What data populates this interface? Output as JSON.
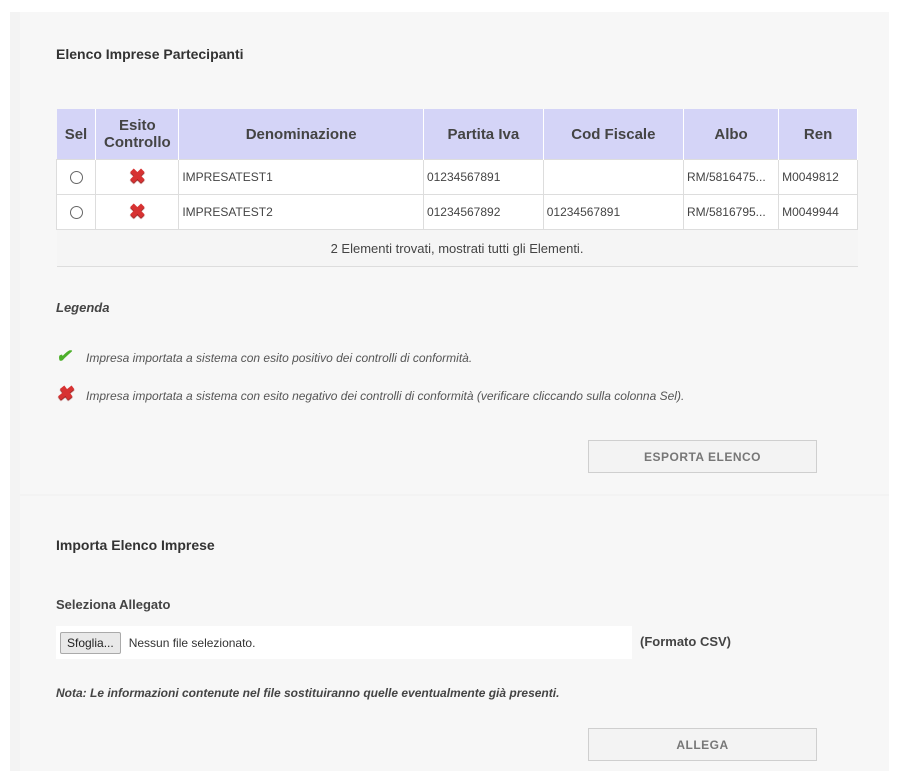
{
  "section1": {
    "title": "Elenco Imprese Partecipanti",
    "table": {
      "headers": [
        "Sel",
        "Esito Controllo",
        "Denominazione",
        "Partita Iva",
        "Cod Fiscale",
        "Albo",
        "Ren"
      ],
      "rows": [
        {
          "denominazione": "IMPRESATEST1",
          "partita_iva": "01234567891",
          "cod_fiscale": "",
          "albo": "RM/5816475...",
          "ren": "M0049812"
        },
        {
          "denominazione": "IMPRESATEST2",
          "partita_iva": "01234567892",
          "cod_fiscale": "01234567891",
          "albo": "RM/5816795...",
          "ren": "M0049944"
        }
      ],
      "footer": "2 Elementi trovati, mostrati tutti gli Elementi."
    },
    "legend": {
      "title": "Legenda",
      "positive": "Impresa importata a sistema con esito positivo dei controlli di conformità.",
      "negative": "Impresa importata a sistema con esito negativo dei controlli di conformità (verificare cliccando sulla colonna Sel)."
    },
    "export_button": "ESPORTA ELENCO"
  },
  "section2": {
    "title": "Importa Elenco Imprese",
    "attach_label": "Seleziona Allegato",
    "browse_button": "Sfoglia...",
    "file_status": "Nessun file selezionato.",
    "format_hint": "(Formato CSV)",
    "note": "Nota: Le informazioni contenute nel file sostituiranno quelle eventualmente già presenti.",
    "attach_button": "ALLEGA"
  },
  "icons": {
    "fail": "x-mark-icon",
    "ok": "check-mark-icon"
  },
  "colors": {
    "header_bg": "#d4d4f7",
    "fail": "#d73232",
    "ok": "#4caf2a"
  }
}
